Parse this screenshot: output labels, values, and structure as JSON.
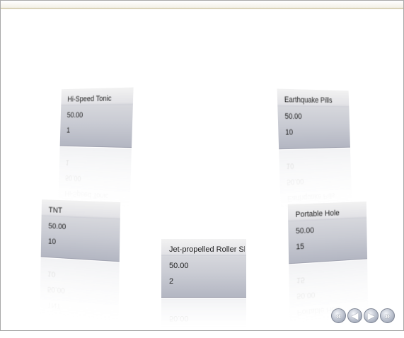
{
  "cards": [
    {
      "name": "Hi-Speed Tonic",
      "price": "50.00",
      "qty": "1"
    },
    {
      "name": "Earthquake Pills",
      "price": "50.00",
      "qty": "10"
    },
    {
      "name": "TNT",
      "price": "50.00",
      "qty": "10"
    },
    {
      "name": "Jet-propelled Roller Skates",
      "price": "50.00",
      "qty": "2"
    },
    {
      "name": "Portable Hole",
      "price": "50.00",
      "qty": "15"
    }
  ],
  "nav": {
    "first_icon": "first-icon",
    "prev_icon": "prev-icon",
    "next_icon": "next-icon",
    "last_icon": "last-icon"
  }
}
